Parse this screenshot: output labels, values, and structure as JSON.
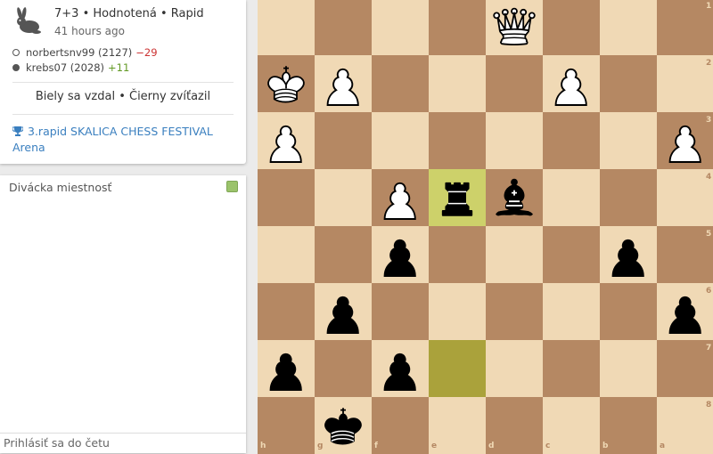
{
  "game": {
    "title": "7+3 • Hodnotená • Rapid",
    "time_ago": "41 hours ago",
    "variant_icon": "rabbit-icon",
    "players": [
      {
        "name": "norbertsnv99 (2127)",
        "diff": "−29",
        "color": "white"
      },
      {
        "name": "krebs07 (2028)",
        "diff": "+11",
        "color": "black"
      }
    ],
    "status": "Biely sa vzdal • Čierny zvíťazil",
    "tournament": "3.rapid SKALICA CHESS FESTIVAL Arena",
    "tournament_icon": "trophy-icon"
  },
  "chat": {
    "title": "Divácka miestnosť",
    "toggle_on": true,
    "input_placeholder": "Prihlásiť sa do četu"
  },
  "board": {
    "orientation": "black",
    "colors": {
      "light": "#f0d9b5",
      "dark": "#b58863",
      "last_move_light": "#cdd16a",
      "last_move_dark": "#aaa23b"
    },
    "last_move": [
      "e7",
      "e4"
    ],
    "files_label": [
      "h",
      "g",
      "f",
      "e",
      "d",
      "c",
      "b",
      "a"
    ],
    "ranks_label": [
      "1",
      "2",
      "3",
      "4",
      "5",
      "6",
      "7",
      "8"
    ],
    "pieces": [
      {
        "square": "d1",
        "piece": "Q"
      },
      {
        "square": "h2",
        "piece": "K"
      },
      {
        "square": "g2",
        "piece": "P"
      },
      {
        "square": "c2",
        "piece": "P"
      },
      {
        "square": "h3",
        "piece": "P"
      },
      {
        "square": "a3",
        "piece": "P"
      },
      {
        "square": "f4",
        "piece": "P"
      },
      {
        "square": "e4",
        "piece": "r"
      },
      {
        "square": "d4",
        "piece": "b"
      },
      {
        "square": "f5",
        "piece": "p"
      },
      {
        "square": "b5",
        "piece": "p"
      },
      {
        "square": "g6",
        "piece": "p"
      },
      {
        "square": "a6",
        "piece": "p"
      },
      {
        "square": "h7",
        "piece": "p"
      },
      {
        "square": "f7",
        "piece": "p"
      },
      {
        "square": "g8",
        "piece": "k"
      }
    ]
  }
}
